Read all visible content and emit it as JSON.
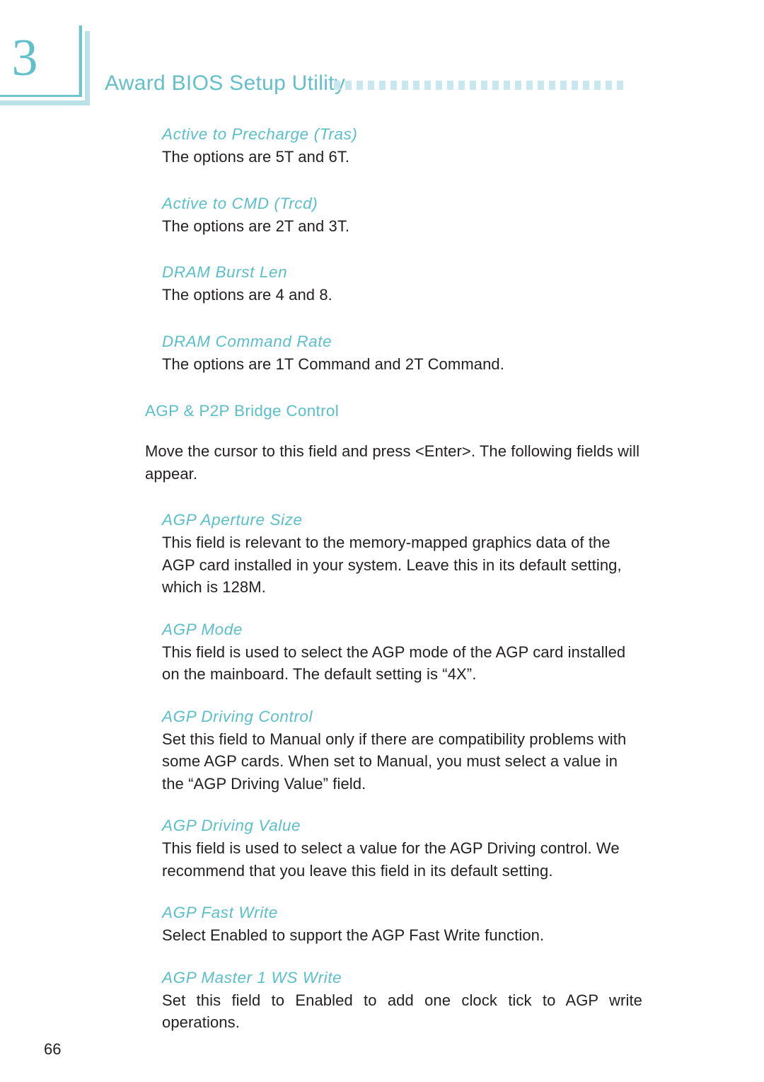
{
  "header": {
    "chapter_number": "3",
    "title": "Award BIOS Setup Utility",
    "rule_square_count": 26,
    "accent_color": "#5bbfca",
    "rule_color": "#c9e8ee"
  },
  "footer": {
    "page_number": "66"
  },
  "sections": [
    {
      "level": 2,
      "heading": "Active to Precharge (Tras)",
      "heading_style": "italic",
      "body": "The options are 5T and 6T."
    },
    {
      "level": 2,
      "heading": "Active to CMD (Trcd)",
      "heading_style": "italic",
      "body": "The options are 2T and 3T."
    },
    {
      "level": 2,
      "heading": "DRAM Burst Len",
      "heading_style": "italic",
      "body": "The options are 4 and 8."
    },
    {
      "level": 2,
      "heading": "DRAM Command Rate",
      "heading_style": "italic",
      "body": "The options are 1T Command and 2T Command."
    },
    {
      "level": 1,
      "heading": "AGP & P2P Bridge Control",
      "heading_style": "normal",
      "body": "Move the cursor to this field and press <Enter>. The following fields will appear."
    },
    {
      "level": 2,
      "heading": "AGP Aperture Size",
      "heading_style": "italic",
      "body": "This field is relevant to the memory-mapped graphics data of the AGP card installed in your system. Leave this in its default setting, which is 128M."
    },
    {
      "level": 2,
      "heading": "AGP Mode",
      "heading_style": "italic",
      "body": "This field is used to select the AGP mode of the AGP card installed on the mainboard. The default setting is “4X”."
    },
    {
      "level": 2,
      "heading": "AGP Driving Control",
      "heading_style": "italic",
      "body": "Set this field to Manual only if there are compatibility problems with some AGP cards. When set to Manual, you must select a value in the “AGP Driving Value” field."
    },
    {
      "level": 2,
      "heading": "AGP Driving Value",
      "heading_style": "italic",
      "body": "This field is used to select a value for the AGP Driving control. We recommend that you leave this field in its default setting."
    },
    {
      "level": 2,
      "heading": "AGP Fast Write",
      "heading_style": "italic",
      "body": "Select Enabled to support the AGP Fast Write function."
    },
    {
      "level": 2,
      "heading": "AGP Master 1 WS Write",
      "heading_style": "italic",
      "body": "Set this field to Enabled to add one clock tick to AGP write operations."
    }
  ]
}
